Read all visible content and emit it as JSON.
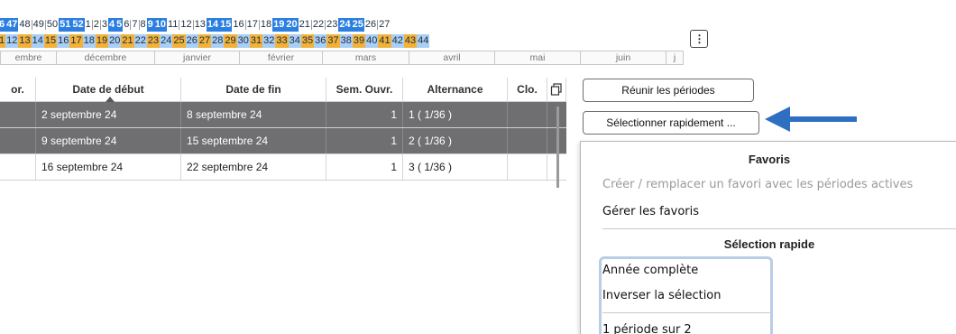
{
  "calendar": {
    "weeks_row1": [
      {
        "label": "6",
        "style": "blue"
      },
      {
        "label": "47",
        "style": "blue"
      },
      {
        "label": "48",
        "style": "white"
      },
      {
        "label": "49",
        "style": "white"
      },
      {
        "label": "50",
        "style": "white"
      },
      {
        "label": "51",
        "style": "blue"
      },
      {
        "label": "52",
        "style": "blue"
      },
      {
        "label": "1",
        "style": "white"
      },
      {
        "label": "2",
        "style": "white"
      },
      {
        "label": "3",
        "style": "white"
      },
      {
        "label": "4",
        "style": "blue"
      },
      {
        "label": "5",
        "style": "blue"
      },
      {
        "label": "6",
        "style": "white"
      },
      {
        "label": "7",
        "style": "white"
      },
      {
        "label": "8",
        "style": "white"
      },
      {
        "label": "9",
        "style": "blue"
      },
      {
        "label": "10",
        "style": "blue"
      },
      {
        "label": "11",
        "style": "white"
      },
      {
        "label": "12",
        "style": "white"
      },
      {
        "label": "13",
        "style": "white"
      },
      {
        "label": "14",
        "style": "blue"
      },
      {
        "label": "15",
        "style": "blue"
      },
      {
        "label": "16",
        "style": "white"
      },
      {
        "label": "17",
        "style": "white"
      },
      {
        "label": "18",
        "style": "white"
      },
      {
        "label": "19",
        "style": "blue"
      },
      {
        "label": "20",
        "style": "blue"
      },
      {
        "label": "21",
        "style": "white"
      },
      {
        "label": "22",
        "style": "white"
      },
      {
        "label": "23",
        "style": "white"
      },
      {
        "label": "24",
        "style": "blue"
      },
      {
        "label": "25",
        "style": "blue"
      },
      {
        "label": "26",
        "style": "white"
      },
      {
        "label": "27",
        "style": "white"
      }
    ],
    "weeks_row2": [
      {
        "label": "1",
        "style": "orange"
      },
      {
        "label": "12",
        "style": "light"
      },
      {
        "label": "13",
        "style": "orange"
      },
      {
        "label": "14",
        "style": "light"
      },
      {
        "label": "15",
        "style": "orange"
      },
      {
        "label": "16",
        "style": "light"
      },
      {
        "label": "17",
        "style": "orange"
      },
      {
        "label": "18",
        "style": "light"
      },
      {
        "label": "19",
        "style": "orange"
      },
      {
        "label": "20",
        "style": "light"
      },
      {
        "label": "21",
        "style": "orange"
      },
      {
        "label": "22",
        "style": "light"
      },
      {
        "label": "23",
        "style": "orange"
      },
      {
        "label": "24",
        "style": "light"
      },
      {
        "label": "25",
        "style": "orange"
      },
      {
        "label": "26",
        "style": "light"
      },
      {
        "label": "27",
        "style": "orange"
      },
      {
        "label": "28",
        "style": "light"
      },
      {
        "label": "29",
        "style": "orange"
      },
      {
        "label": "30",
        "style": "light"
      },
      {
        "label": "31",
        "style": "orange"
      },
      {
        "label": "32",
        "style": "light"
      },
      {
        "label": "33",
        "style": "orange"
      },
      {
        "label": "34",
        "style": "light"
      },
      {
        "label": "35",
        "style": "orange"
      },
      {
        "label": "36",
        "style": "light"
      },
      {
        "label": "37",
        "style": "orange"
      },
      {
        "label": "38",
        "style": "light"
      },
      {
        "label": "39",
        "style": "orange"
      },
      {
        "label": "40",
        "style": "light"
      },
      {
        "label": "41",
        "style": "orange"
      },
      {
        "label": "42",
        "style": "light"
      },
      {
        "label": "43",
        "style": "orange"
      },
      {
        "label": "44",
        "style": "light"
      }
    ],
    "months": [
      "embre",
      "décembre",
      "janvier",
      "février",
      "mars",
      "avril",
      "mai",
      "juin",
      "j"
    ],
    "more_label": "⋮"
  },
  "table": {
    "headers": [
      "or.",
      "Date de début",
      "Date de fin",
      "Sem. Ouvr.",
      "Alternance",
      "Clo."
    ],
    "rows": [
      {
        "start": "2 septembre 24",
        "end": "8 septembre 24",
        "weeks": "1",
        "alternance": "1 ( 1/36 )",
        "selected": true
      },
      {
        "start": "9 septembre 24",
        "end": "15 septembre 24",
        "weeks": "1",
        "alternance": "2 ( 1/36 )",
        "selected": true
      },
      {
        "start": "16 septembre 24",
        "end": "22 septembre 24",
        "weeks": "1",
        "alternance": "3 ( 1/36 )",
        "selected": false
      }
    ]
  },
  "buttons": {
    "merge": "Réunir les périodes",
    "quick_select": "Sélectionner rapidement ..."
  },
  "menu": {
    "favorites_header": "Favoris",
    "favorites_items": [
      {
        "label": "Créer / remplacer un favori avec les périodes actives",
        "disabled": true
      },
      {
        "label": "Gérer les favoris",
        "disabled": false
      }
    ],
    "quick_header": "Sélection rapide",
    "quick_items": [
      "Année complète",
      "Inverser la sélection",
      "1 période sur 2"
    ]
  },
  "colors": {
    "accent_blue": "#2b7fe0",
    "light_blue": "#a9cff7",
    "orange": "#f2b23a",
    "selected_row": "#6f6f72",
    "arrow": "#2f6fc2"
  }
}
